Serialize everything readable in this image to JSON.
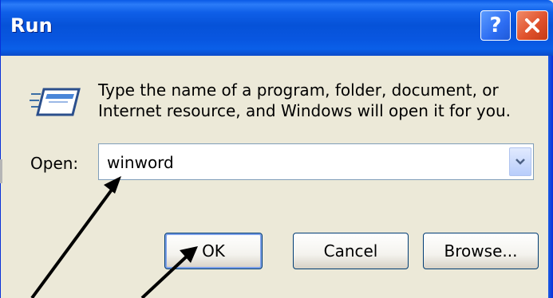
{
  "window": {
    "title": "Run",
    "help_label": "?"
  },
  "dialog": {
    "description_line1": "Type the name of a program, folder, document, or",
    "description_line2": "Internet resource, and Windows will open it for you.",
    "open_label": "Open:",
    "open_value": "winword"
  },
  "buttons": {
    "ok": "OK",
    "cancel": "Cancel",
    "browse": "Browse..."
  },
  "colors": {
    "titlebar": "#0652d8",
    "dialog_bg": "#ece9d8",
    "close": "#e0522c"
  }
}
